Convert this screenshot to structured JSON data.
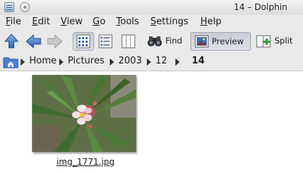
{
  "window": {
    "title": "14 – Dolphin"
  },
  "menu": {
    "items": [
      {
        "label": "File",
        "mnemonic": "F",
        "rest": "ile"
      },
      {
        "label": "Edit",
        "mnemonic": "E",
        "rest": "dit"
      },
      {
        "label": "View",
        "mnemonic": "V",
        "rest": "iew"
      },
      {
        "label": "Go",
        "mnemonic": "G",
        "rest": "o"
      },
      {
        "label": "Tools",
        "mnemonic": "T",
        "rest": "ools"
      },
      {
        "label": "Settings",
        "mnemonic": "S",
        "rest": "ettings"
      },
      {
        "label": "Help",
        "mnemonic": "H",
        "rest": "elp"
      }
    ]
  },
  "toolbar": {
    "find_label": "Find",
    "preview_label": "Preview",
    "split_label": "Split",
    "active_view_mode": "icons",
    "preview_active": true,
    "icons": {
      "up": "arrow-up-icon",
      "back": "arrow-left-icon",
      "forward": "arrow-right-icon",
      "icons_view": "icons-view-icon",
      "details_view": "details-view-icon",
      "columns_view": "columns-view-icon",
      "find": "binoculars-icon",
      "preview": "preview-icon",
      "split": "split-view-icon"
    }
  },
  "breadcrumb": {
    "home_icon": "folder-home-icon",
    "items": [
      "Home",
      "Pictures",
      "2003",
      "12",
      "14"
    ],
    "current": "14"
  },
  "files": [
    {
      "name": "img_1771.jpg",
      "thumbnail": "flower-photo"
    }
  ],
  "colors": {
    "accent": "#3d6fbf",
    "toolbar_bg": "#e9e9e9",
    "view_bg": "#ffffff"
  }
}
